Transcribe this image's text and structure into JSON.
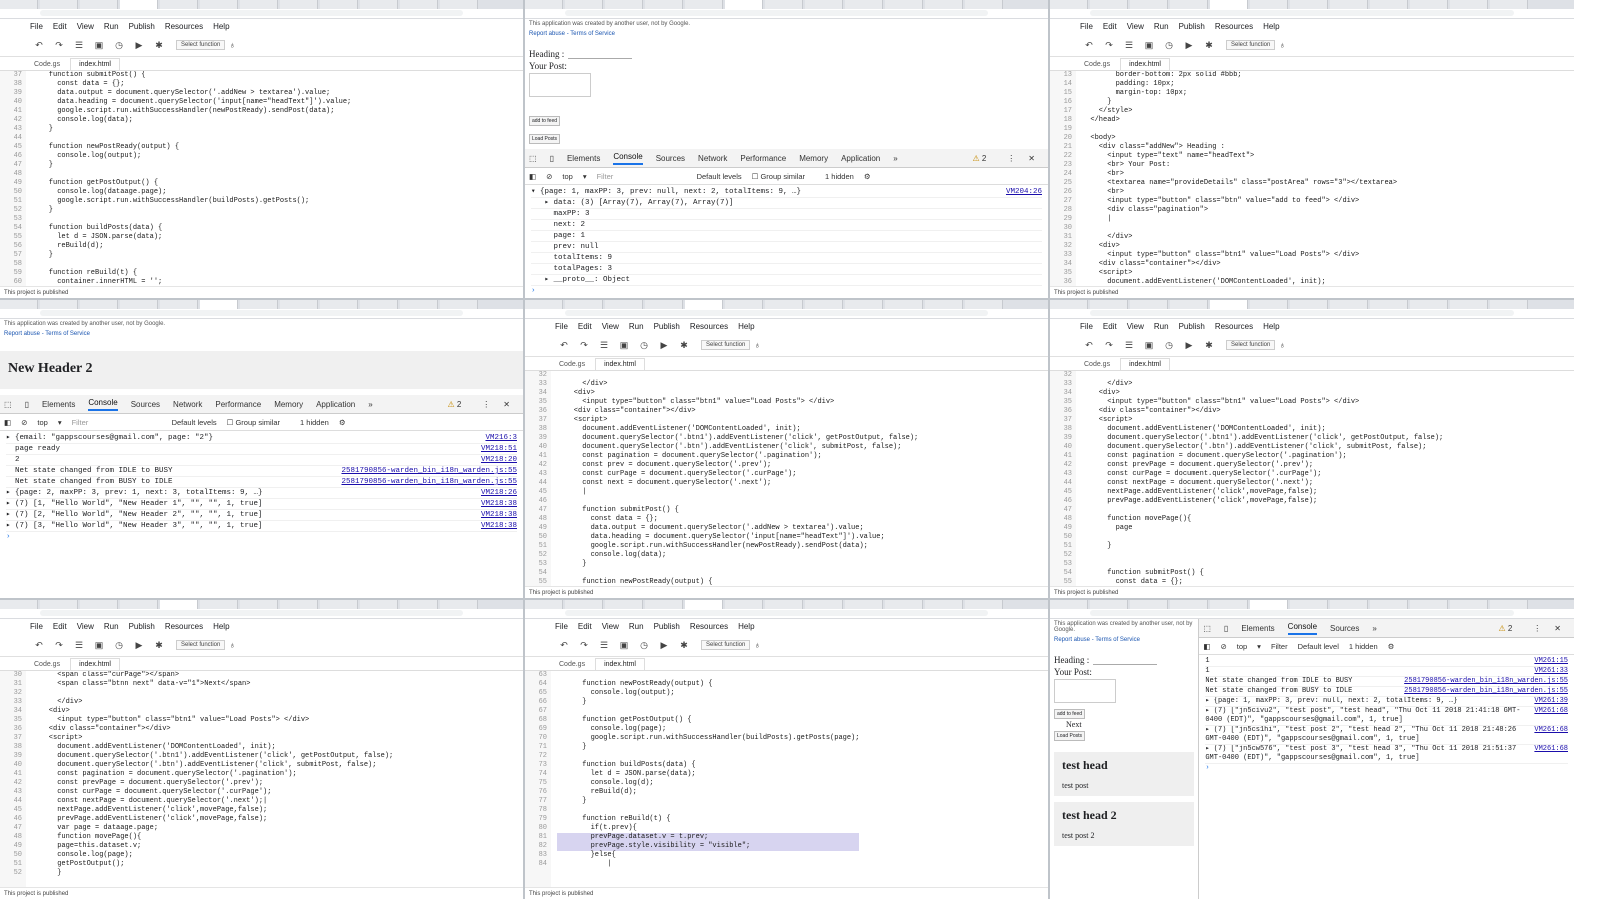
{
  "menu": [
    "File",
    "Edit",
    "View",
    "Run",
    "Publish",
    "Resources",
    "Help"
  ],
  "toolbar": {
    "select_function": "Select function"
  },
  "files": {
    "code": "Code.gs",
    "index": "index.html"
  },
  "status": {
    "published": "This project is published"
  },
  "banner": {
    "notice": "This application was created by another user, not by Google.",
    "links": "Report abuse - Terms of Service"
  },
  "form": {
    "heading": "Heading :",
    "your_post": "Your Post:",
    "add_to_feed": "add to feed",
    "load_posts": "Load Posts",
    "next": "Next"
  },
  "devtools": {
    "tabs": [
      "Elements",
      "Console",
      "Sources",
      "Network",
      "Performance",
      "Memory",
      "Application"
    ],
    "warnings": "2",
    "context": "top",
    "filter_placeholder": "Filter",
    "default_levels": "Default levels",
    "group_similar": "Group similar",
    "hidden": "1 hidden"
  },
  "p1": {
    "lines": [
      "37",
      "38",
      "39",
      "40",
      "41",
      "42",
      "43",
      "44",
      "45",
      "46",
      "47",
      "48",
      "49",
      "50",
      "51",
      "52",
      "53",
      "54",
      "55",
      "56",
      "57",
      "58",
      "59",
      "60"
    ],
    "code": [
      "    function submitPost() {",
      "      const data = {};",
      "      data.output = document.querySelector('.addNew > textarea').value;",
      "      data.heading = document.querySelector('input[name=\"headText\"]').value;",
      "      google.script.run.withSuccessHandler(newPostReady).sendPost(data);",
      "      console.log(data);",
      "    }",
      "",
      "    function newPostReady(output) {",
      "      console.log(output);",
      "    }",
      "",
      "    function getPostOutput() {",
      "      console.log(dataage.page);",
      "      google.script.run.withSuccessHandler(buildPosts).getPosts();",
      "    }",
      "",
      "    function buildPosts(data) {",
      "      let d = JSON.parse(data);",
      "      reBuild(d);",
      "    }",
      "",
      "    function reBuild(t) {",
      "      container.innerHTML = '';"
    ]
  },
  "p2": {
    "console": [
      {
        "t": "▾ {page: 1, maxPP: 3, prev: null, next: 2, totalItems: 9, …}",
        "s": "VM204:26"
      },
      {
        "t": "   ▸ data: (3) [Array(7), Array(7), Array(7)]",
        "s": ""
      },
      {
        "t": "     maxPP: 3",
        "s": ""
      },
      {
        "t": "     next: 2",
        "s": ""
      },
      {
        "t": "     page: 1",
        "s": ""
      },
      {
        "t": "     prev: null",
        "s": ""
      },
      {
        "t": "     totalItems: 9",
        "s": ""
      },
      {
        "t": "     totalPages: 3",
        "s": ""
      },
      {
        "t": "   ▸ __proto__: Object",
        "s": ""
      }
    ]
  },
  "p3": {
    "lines": [
      "13",
      "14",
      "15",
      "16",
      "17",
      "18",
      "19",
      "20",
      "21",
      "22",
      "23",
      "24",
      "25",
      "26",
      "27",
      "28",
      "29",
      "30",
      "31",
      "32",
      "33",
      "34",
      "35",
      "36"
    ],
    "code": [
      "        border-bottom: 2px solid #bbb;",
      "        padding: 10px;",
      "        margin-top: 10px;",
      "      }",
      "    </style>",
      "  </head>",
      "",
      "  <body>",
      "    <div class=\"addNew\"> Heading :",
      "      <input type=\"text\" name=\"headText\">",
      "      <br> Your Post:",
      "      <br>",
      "      <textarea name=\"provideDetails\" class=\"postArea\" rows=\"3\"></textarea>",
      "      <br>",
      "      <input type=\"button\" class=\"btn\" value=\"add to feed\"> </div>",
      "      <div class=\"pagination\">",
      "      |",
      "",
      "      </div>",
      "    <div>",
      "      <input type=\"button\" class=\"btn1\" value=\"Load Posts\"> </div>",
      "    <div class=\"container\"></div>",
      "    <script>",
      "      document.addEventListener('DOMContentLoaded', init);"
    ]
  },
  "p4": {
    "header": "New Header 2",
    "console": [
      {
        "t": "▸ {email: \"gappscourses@gmail.com\", page: \"2\"}",
        "s": "VM216:3"
      },
      {
        "t": "  page ready",
        "s": "VM218:51"
      },
      {
        "t": "  2",
        "s": "VM218:20"
      },
      {
        "t": "  Net state changed from IDLE to BUSY",
        "s": "2581790856-warden_bin_i18n_warden.js:55"
      },
      {
        "t": "  Net state changed from BUSY to IDLE",
        "s": "2581790856-warden_bin_i18n_warden.js:55"
      },
      {
        "t": "▸ {page: 2, maxPP: 3, prev: 1, next: 3, totalItems: 9, …}",
        "s": "VM218:26"
      },
      {
        "t": "▸ (7) [1, \"Hello World\", \"New Header 1\", \"\", \"\", 1, true]",
        "s": "VM218:38"
      },
      {
        "t": "▸ (7) [2, \"Hello World\", \"New Header 2\", \"\", \"\", 1, true]",
        "s": "VM218:38"
      },
      {
        "t": "▸ (7) [3, \"Hello World\", \"New Header 3\", \"\", \"\", 1, true]",
        "s": "VM218:38"
      }
    ]
  },
  "p5": {
    "lines": [
      "32",
      "33",
      "34",
      "35",
      "36",
      "37",
      "38",
      "39",
      "40",
      "41",
      "42",
      "43",
      "44",
      "45",
      "46",
      "47",
      "48",
      "49",
      "50",
      "51",
      "52",
      "53",
      "54",
      "55"
    ],
    "code": [
      "",
      "      </div>",
      "    <div>",
      "      <input type=\"button\" class=\"btn1\" value=\"Load Posts\"> </div>",
      "    <div class=\"container\"></div>",
      "    <script>",
      "      document.addEventListener('DOMContentLoaded', init);",
      "      document.querySelector('.btn1').addEventListener('click', getPostOutput, false);",
      "      document.querySelector('.btn').addEventListener('click', submitPost, false);",
      "      const pagination = document.querySelector('.pagination');",
      "      const prev = document.querySelector('.prev');",
      "      const curPage = document.querySelector('.curPage');",
      "      const next = document.querySelector('.next');",
      "      |",
      "",
      "      function submitPost() {",
      "        const data = {};",
      "        data.output = document.querySelector('.addNew > textarea').value;",
      "        data.heading = document.querySelector('input[name=\"headText\"]').value;",
      "        google.script.run.withSuccessHandler(newPostReady).sendPost(data);",
      "        console.log(data);",
      "      }",
      "",
      "      function newPostReady(output) {"
    ]
  },
  "p6": {
    "lines": [
      "32",
      "33",
      "34",
      "35",
      "36",
      "37",
      "38",
      "39",
      "40",
      "41",
      "42",
      "43",
      "44",
      "45",
      "46",
      "47",
      "48",
      "49",
      "50",
      "51",
      "52",
      "53",
      "54",
      "55"
    ],
    "code": [
      "",
      "      </div>",
      "    <div>",
      "      <input type=\"button\" class=\"btn1\" value=\"Load Posts\"> </div>",
      "    <div class=\"container\"></div>",
      "    <script>",
      "      document.addEventListener('DOMContentLoaded', init);",
      "      document.querySelector('.btn1').addEventListener('click', getPostOutput, false);",
      "      document.querySelector('.btn').addEventListener('click', submitPost, false);",
      "      const pagination = document.querySelector('.pagination');",
      "      const prevPage = document.querySelector('.prev');",
      "      const curPage = document.querySelector('.curPage');",
      "      const nextPage = document.querySelector('.next');",
      "      nextPage.addEventListener('click',movePage,false);",
      "      prevPage.addEventListener('click',movePage,false);",
      "",
      "      function movePage(){",
      "        page",
      "",
      "      }",
      "",
      "",
      "      function submitPost() {",
      "        const data = {};"
    ]
  },
  "p7": {
    "lines": [
      "30",
      "31",
      "32",
      "33",
      "34",
      "35",
      "36",
      "37",
      "38",
      "39",
      "40",
      "41",
      "42",
      "43",
      "44",
      "45",
      "46",
      "47",
      "48",
      "49",
      "50",
      "51",
      "52"
    ],
    "code": [
      "      <span class=\"curPage\"></span>",
      "      <span class=\"btnn next\" data-v=\"1\">Next</span>",
      "",
      "      </div>",
      "    <div>",
      "      <input type=\"button\" class=\"btn1\" value=\"Load Posts\"> </div>",
      "    <div class=\"container\"></div>",
      "    <script>",
      "      document.addEventListener('DOMContentLoaded', init);",
      "      document.querySelector('.btn1').addEventListener('click', getPostOutput, false);",
      "      document.querySelector('.btn').addEventListener('click', submitPost, false);",
      "      const pagination = document.querySelector('.pagination');",
      "      const prevPage = document.querySelector('.prev');",
      "      const curPage = document.querySelector('.curPage');",
      "      const nextPage = document.querySelector('.next');|",
      "      nextPage.addEventListener('click',movePage,false);",
      "      prevPage.addEventListener('click',movePage,false);",
      "      var page = dataage.page;",
      "      function movePage(){",
      "      page=this.dataset.v;",
      "      console.log(page);",
      "      getPostOutput();",
      "      }"
    ]
  },
  "p8": {
    "lines": [
      "63",
      "64",
      "65",
      "66",
      "67",
      "68",
      "69",
      "70",
      "71",
      "72",
      "73",
      "74",
      "75",
      "76",
      "77",
      "78",
      "79",
      "80",
      "81",
      "82",
      "83",
      "84"
    ],
    "code": [
      "",
      "      function newPostReady(output) {",
      "        console.log(output);",
      "      }",
      "",
      "      function getPostOutput() {",
      "        console.log(page);",
      "        google.script.run.withSuccessHandler(buildPosts).getPosts(page);",
      "      }",
      "",
      "      function buildPosts(data) {",
      "        let d = JSON.parse(data);",
      "        console.log(d);",
      "        reBuild(d);",
      "      }",
      "",
      "      function reBuild(t) {",
      "        if(t.prev){",
      "        prevPage.dataset.v = t.prev;",
      "        prevPage.style.visibility = \"visible\";",
      "        }else{",
      "            |"
    ]
  },
  "p9": {
    "posts": [
      {
        "head": "test head",
        "body": "test post"
      },
      {
        "head": "test head 2",
        "body": "test post 2"
      }
    ],
    "context": "top",
    "default_level": "Default level",
    "console": [
      {
        "t": "1",
        "s": "VM261:15"
      },
      {
        "t": "1",
        "s": "VM261:33"
      },
      {
        "t": "Net state changed from IDLE to BUSY",
        "s": "2581790856-warden_bin_i18n_warden.js:55"
      },
      {
        "t": "Net state changed from BUSY to IDLE",
        "s": "2581790856-warden_bin_i18n_warden.js:55"
      },
      {
        "t": "▸ {page: 1, maxPP: 3, prev: null, next: 2, totalItems: 9, …}",
        "s": "VM261:39"
      },
      {
        "t": "▸ (7) [\"jn5civu2\", \"test post\", \"test head\", \"Thu Oct 11 2018 21:41:18 GMT-0400 (EDT)\", \"gappscourses@gmail.com\", 1, true]",
        "s": "VM261:68"
      },
      {
        "t": "▸ (7) [\"jn5cs1hi\", \"test post 2\", \"test head 2\", \"Thu Oct 11 2018 21:48:26 GMT-0400 (EDT)\", \"gappscourses@gmail.com\", 1, true]",
        "s": "VM261:68"
      },
      {
        "t": "▸ (7) [\"jn5cw576\", \"test post 3\", \"test head 3\", \"Thu Oct 11 2018 21:51:37 GMT-0400 (EDT)\", \"gappscourses@gmail.com\", 1, true]",
        "s": "VM261:68"
      }
    ]
  }
}
